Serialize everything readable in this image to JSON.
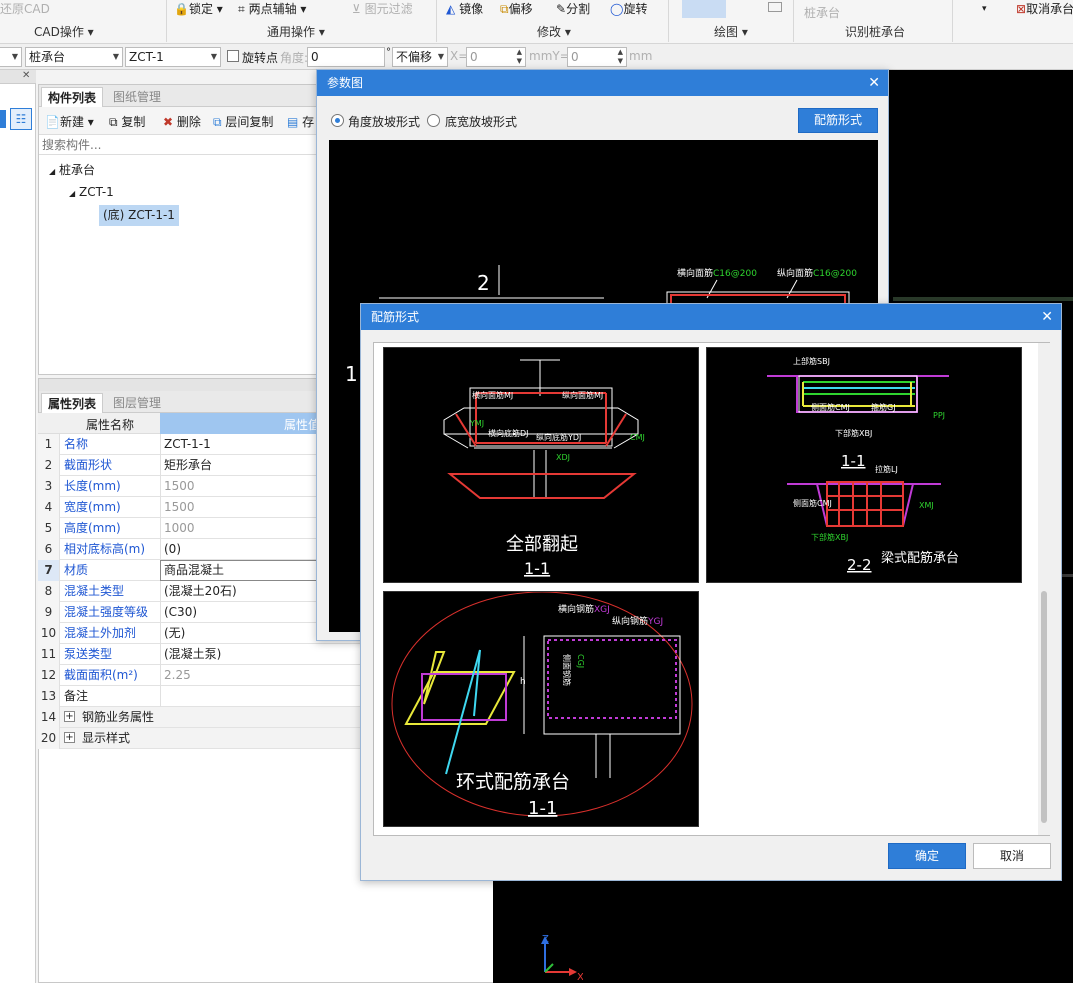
{
  "ribbon": {
    "restore_cad": "还原CAD",
    "group_cad_ops": "CAD操作",
    "lock": "锁定",
    "two_point_axis": "两点辅轴",
    "filter": "图元过滤",
    "group_common_ops": "通用操作",
    "mirror": "镜像",
    "offset": "偏移",
    "split": "分割",
    "rotate": "旋转",
    "group_modify": "修改",
    "group_draw": "绘图",
    "pile_cap": "桩承台",
    "group_identify": "识别桩承台",
    "cancel_cap": "取消承台"
  },
  "toolbar2": {
    "combo1": "",
    "combo_category": "桩承台",
    "combo_element": "ZCT-1",
    "rotate_point": "旋转点",
    "angle_label": "角度:",
    "angle_value": "0",
    "degree_unit": "°",
    "offset_mode": "不偏移",
    "x_label": "X=",
    "x_value": "0",
    "mm1": "mm",
    "y_label": "Y=",
    "y_value": "0",
    "mm2": "mm"
  },
  "component_panel": {
    "tab_list": "构件列表",
    "tab_drawings": "图纸管理",
    "new": "新建",
    "copy": "复制",
    "delete": "删除",
    "layer_copy": "层间复制",
    "save": "存",
    "search_placeholder": "搜索构件...",
    "tree": [
      {
        "label": "桩承台",
        "level": 0
      },
      {
        "label": "ZCT-1",
        "level": 1
      },
      {
        "label": "(底) ZCT-1-1",
        "level": 2
      }
    ]
  },
  "property_panel": {
    "tab_props": "属性列表",
    "tab_layers": "图层管理",
    "col_name": "属性名称",
    "col_value": "属性值",
    "rows": [
      {
        "num": "1",
        "name": "名称",
        "value": "ZCT-1-1",
        "blue": true,
        "gray": false
      },
      {
        "num": "2",
        "name": "截面形状",
        "value": "矩形承台",
        "blue": true,
        "gray": false
      },
      {
        "num": "3",
        "name": "长度(mm)",
        "value": "1500",
        "blue": true,
        "gray": true
      },
      {
        "num": "4",
        "name": "宽度(mm)",
        "value": "1500",
        "blue": true,
        "gray": true
      },
      {
        "num": "5",
        "name": "高度(mm)",
        "value": "1000",
        "blue": true,
        "gray": true
      },
      {
        "num": "6",
        "name": "相对底标高(m)",
        "value": "(0)",
        "blue": true,
        "gray": false
      },
      {
        "num": "7",
        "name": "材质",
        "value": "商品混凝土",
        "blue": true,
        "gray": false
      },
      {
        "num": "8",
        "name": "混凝土类型",
        "value": "(混凝土20石)",
        "blue": true,
        "gray": false
      },
      {
        "num": "9",
        "name": "混凝土强度等级",
        "value": "(C30)",
        "blue": true,
        "gray": false
      },
      {
        "num": "10",
        "name": "混凝土外加剂",
        "value": "(无)",
        "blue": true,
        "gray": false
      },
      {
        "num": "11",
        "name": "泵送类型",
        "value": "(混凝土泵)",
        "blue": true,
        "gray": false
      },
      {
        "num": "12",
        "name": "截面面积(m²)",
        "value": "2.25",
        "blue": true,
        "gray": true
      },
      {
        "num": "13",
        "name": "备注",
        "value": "",
        "blue": false,
        "gray": false
      },
      {
        "num": "14",
        "name": "钢筋业务属性",
        "value": "",
        "blue": false,
        "gray": false,
        "expand": true
      },
      {
        "num": "20",
        "name": "显示样式",
        "value": "",
        "blue": false,
        "gray": false,
        "expand": true
      }
    ]
  },
  "param_dialog": {
    "title": "参数图",
    "radio_angle": "角度放坡形式",
    "radio_width": "底宽放坡形式",
    "rebar_button": "配筋形式",
    "label_2": "2",
    "label_1": "1",
    "top_rebar_h": "横向面筋",
    "top_rebar_h_val": "C16@200",
    "top_rebar_v": "纵向面筋",
    "top_rebar_v_val": "C16@200"
  },
  "rebar_dialog": {
    "title": "配筋形式",
    "ok": "确定",
    "cancel": "取消",
    "tiles": [
      {
        "caption": "全部翻起",
        "section": "1-1",
        "labels": [
          "横向面筋MJ",
          "纵向面筋MJ",
          "横向底筋DJ",
          "纵向底筋YDJ",
          "CMJ",
          "YMJ",
          "XDJ"
        ]
      },
      {
        "caption": "梁式配筋承台",
        "section_a": "1-1",
        "section_b": "2-2",
        "labels": [
          "上部筋SBJ",
          "侧面筋CMJ",
          "下部筋XBJ",
          "箍筋GJ",
          "侧面筋CMJ",
          "PPJ",
          "下部筋XBJ",
          "拉筋LJ",
          "XMJ"
        ]
      },
      {
        "caption": "环式配筋承台",
        "section": "1-1",
        "labels": [
          "横向钢筋",
          "XGJ",
          "纵向钢筋",
          "YGJ",
          "侧面钢筋",
          "CGJ",
          "h"
        ]
      }
    ]
  },
  "colors": {
    "accent": "#2f7ed8",
    "cad_bg": "#000000",
    "highlight_circle": "#d9302c"
  }
}
